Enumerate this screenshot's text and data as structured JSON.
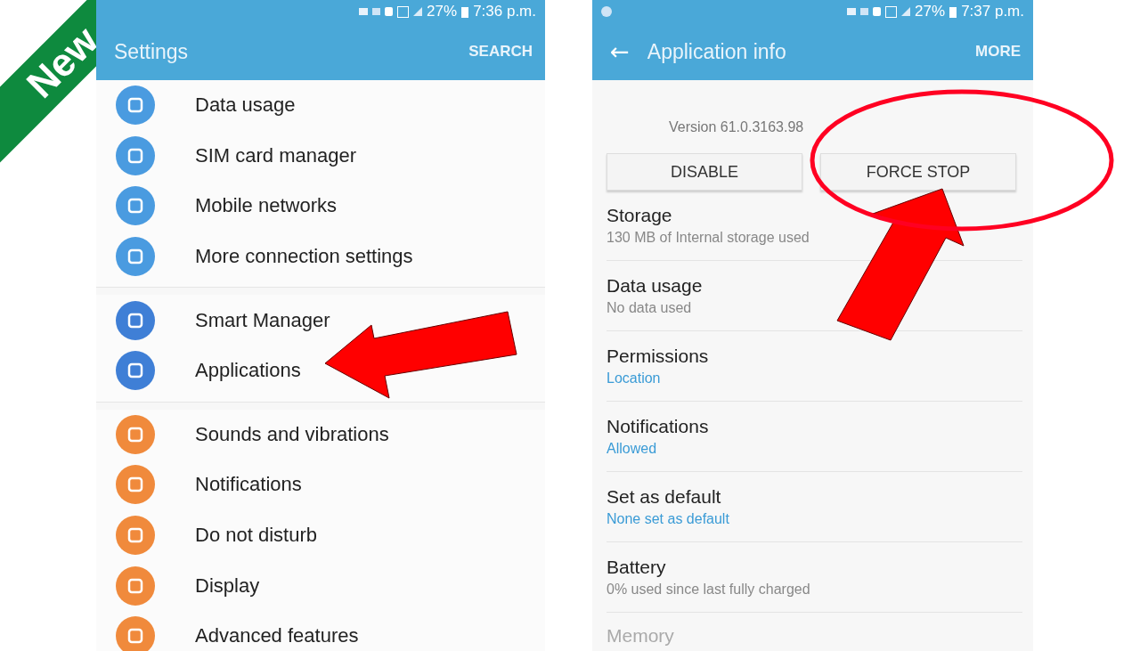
{
  "ribbon": {
    "label": "New"
  },
  "settings_screen": {
    "status_bar": {
      "battery": "27%",
      "time": "7:36 p.m."
    },
    "title": "Settings",
    "action": "SEARCH",
    "groups": [
      {
        "items": [
          {
            "label": "Data usage",
            "color": "#4a9be0"
          },
          {
            "label": "SIM card manager",
            "color": "#4a9be0"
          },
          {
            "label": "Mobile networks",
            "color": "#4a9be0"
          },
          {
            "label": "More connection settings",
            "color": "#4a9be0"
          }
        ]
      },
      {
        "items": [
          {
            "label": "Smart Manager",
            "color": "#3f7fd6"
          },
          {
            "label": "Applications",
            "color": "#3f7fd6"
          }
        ]
      },
      {
        "items": [
          {
            "label": "Sounds and vibrations",
            "color": "#f08a3c"
          },
          {
            "label": "Notifications",
            "color": "#f08a3c"
          },
          {
            "label": "Do not disturb",
            "color": "#f08a3c"
          },
          {
            "label": "Display",
            "color": "#f08a3c"
          },
          {
            "label": "Advanced features",
            "color": "#f08a3c"
          }
        ]
      }
    ]
  },
  "app_info_screen": {
    "status_bar": {
      "battery": "27%",
      "time": "7:37 p.m."
    },
    "back": "←",
    "title": "Application info",
    "action": "MORE",
    "version": "Version 61.0.3163.98",
    "buttons": [
      "DISABLE",
      "FORCE STOP"
    ],
    "items": [
      {
        "title": "Storage",
        "subtitle": "130 MB of Internal storage used",
        "kind": "plain"
      },
      {
        "title": "Data usage",
        "subtitle": "No data used",
        "kind": "plain"
      },
      {
        "title": "Permissions",
        "subtitle": "Location",
        "kind": "link"
      },
      {
        "title": "Notifications",
        "subtitle": "Allowed",
        "kind": "link"
      },
      {
        "title": "Set as default",
        "subtitle": "None set as default",
        "kind": "link"
      },
      {
        "title": "Battery",
        "subtitle": "0% used since last fully charged",
        "kind": "plain"
      },
      {
        "title": "Memory"
      }
    ]
  }
}
